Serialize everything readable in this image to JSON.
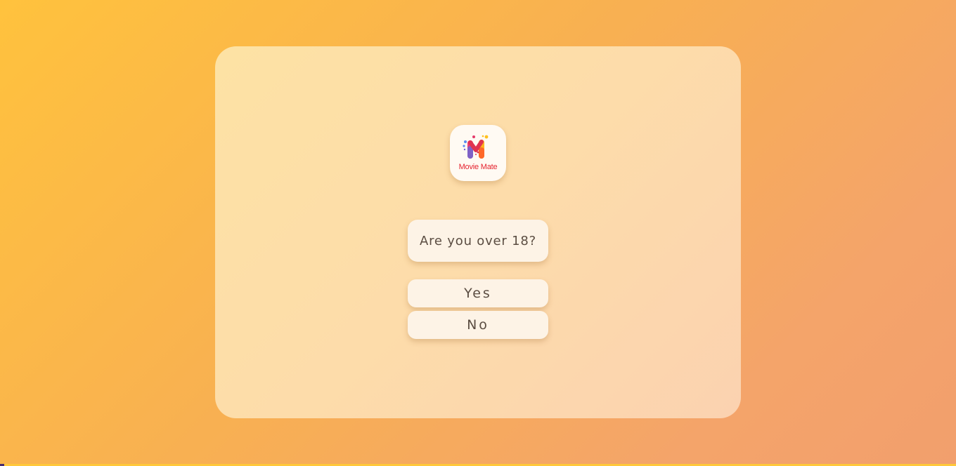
{
  "logo": {
    "text": "Movie Mate",
    "icon": "movie-mate-logo-icon",
    "text_color": "#e5232f"
  },
  "prompt": {
    "question": "Are you over 18?"
  },
  "buttons": {
    "yes_label": "Yes",
    "no_label": "No"
  },
  "colors": {
    "background_start": "#ffc23d",
    "background_end": "#f29f6d",
    "card": "#fddcaa",
    "button_bg": "#fdf3e6",
    "text": "#5b4d42"
  }
}
